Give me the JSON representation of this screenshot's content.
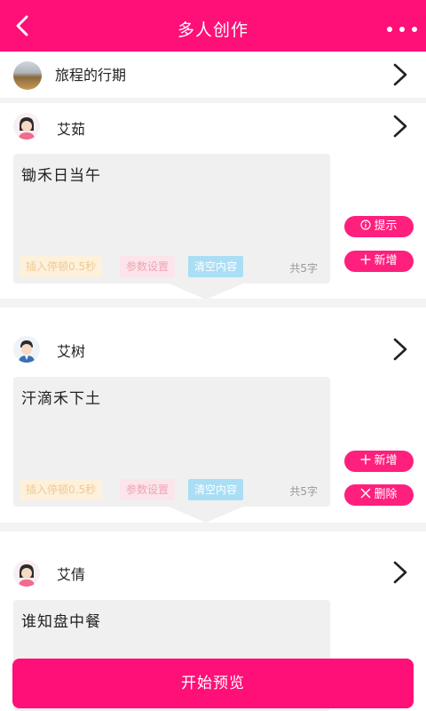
{
  "header": {
    "title": "多人创作"
  },
  "work": {
    "title": "旅程的行期"
  },
  "sections": [
    {
      "speaker": "艾茹",
      "text": "锄禾日当午",
      "chips": [
        "插入停顿0.5秒",
        "参数设置",
        "清空内容"
      ],
      "count": "共5字",
      "actions": [
        "提示",
        "新增"
      ]
    },
    {
      "speaker": "艾树",
      "text": "汗滴禾下土",
      "chips": [
        "插入停顿0.5秒",
        "参数设置",
        "清空内容"
      ],
      "count": "共5字",
      "actions": [
        "新增",
        "删除"
      ]
    },
    {
      "speaker": "艾倩",
      "text": "谁知盘中餐"
    }
  ],
  "footer": {
    "preview_label": "开始预览"
  },
  "colors": {
    "accent": "#ff0f78",
    "pill": "#ff1f7d"
  },
  "icons": [
    "back-icon",
    "more-icon",
    "chevron-right-icon",
    "info-icon",
    "plus-icon",
    "close-icon",
    "female-avatar-icon",
    "male-avatar-icon"
  ]
}
